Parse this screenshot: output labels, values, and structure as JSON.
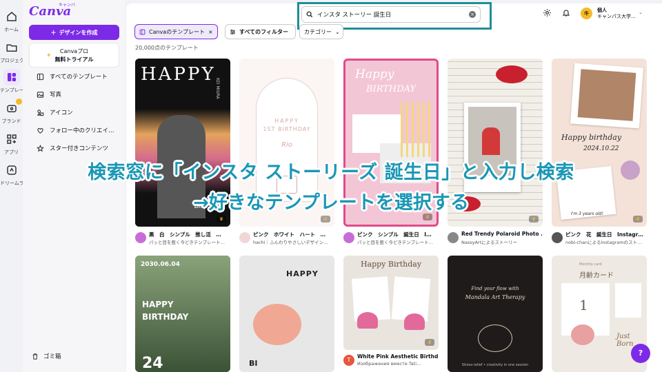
{
  "rail": {
    "items": [
      {
        "label": "ホーム",
        "icon": "home-icon"
      },
      {
        "label": "プロジェクト",
        "icon": "folder-icon"
      },
      {
        "label": "テンプレート",
        "icon": "template-icon"
      },
      {
        "label": "ブランド",
        "icon": "brand-icon"
      },
      {
        "label": "アプリ",
        "icon": "apps-icon"
      },
      {
        "label": "ドリームラボ",
        "icon": "dream-lab-icon"
      }
    ]
  },
  "panel": {
    "logo": "Canva",
    "logo_sub": "キャンバ",
    "create_label": "デザインを作成",
    "pro_line1": "Canvaプロ",
    "pro_line2": "無料トライアル",
    "nav": [
      {
        "label": "すべてのテンプレート"
      },
      {
        "label": "写真"
      },
      {
        "label": "アイコン"
      },
      {
        "label": "フォロー中のクリエイ…"
      },
      {
        "label": "スター付きコンテンツ"
      }
    ],
    "trash_label": "ゴミ箱"
  },
  "header": {
    "search_value": "インスタ ストーリー 誕生日",
    "user_name": "個人",
    "user_org": "キャンパス大学...",
    "avatar_initial": "キ"
  },
  "filters": {
    "selected_chip": "Canvaのテンプレート",
    "all_filters": "すべてのフィルター",
    "category": "カテゴリー"
  },
  "result_count": "20,000点のテンプレート",
  "templates": [
    {
      "title": "黒　白　シンプル　推し活　…",
      "author": "パッと目を惹く今どきテンプレート…",
      "art": "HAPPY",
      "art2": "KEI MIURA",
      "art3": "BIRTHDAY",
      "av": "#c86dd7"
    },
    {
      "title": "ピンク　ホワイト　ハート　…",
      "author": "hachi｜ふんわりやさしいデザイン…",
      "art": "HAPPY",
      "art2": "1ST BIRTHDAY",
      "art3": "Rio",
      "av": "#f1d6d8"
    },
    {
      "title": "ピンク　シンプル　誕生日　I…",
      "author": "パッと目を惹く今どきテンプレート…",
      "art": "Happy",
      "art2": "BIRTHDAY",
      "art3": "",
      "av": "#c86dd7"
    },
    {
      "title": "Red Trendy Polaroid Photo …",
      "author": "NassyArtによるストーリー",
      "art": "",
      "art2": "",
      "art3": "",
      "av": "#888888"
    },
    {
      "title": "ピンク　花　誕生日　Instagr…",
      "author": "nobi-chanによるInstagramのスト…",
      "art": "Happy birthday",
      "art2": "2024.10.22",
      "art3": "I'm 3 years old!",
      "av": "#555555"
    },
    {
      "title": "",
      "author": "",
      "art": "HAPPY",
      "art2": "BIRTHDAY",
      "art3": "2030.06.04",
      "art4": "24",
      "av": ""
    },
    {
      "title": "",
      "author": "",
      "art": "HAPPY",
      "art2": "BI",
      "art3": "",
      "av": ""
    },
    {
      "title": "White Pink Aesthetic Birthd…",
      "author": "Изображения вместе Tati…",
      "art": "Happy Birthday",
      "art2": "",
      "art3": "",
      "av": "#e8563d",
      "av_letter": "T"
    },
    {
      "title": "",
      "author": "",
      "art": "Find your flow with",
      "art2": "Mandala Art Therapy",
      "art3": "Stress-relief • creativity in one session",
      "av": ""
    },
    {
      "title": "",
      "author": "",
      "art": "月齢カード",
      "art2": "1",
      "art3": "Just Born",
      "art4": "Monthly card",
      "av": ""
    }
  ],
  "caption": {
    "line1": "検索窓に「インスタ ストーリーズ 誕生日」と入力し検索",
    "line2": "→好きなテンプレートを選択する"
  },
  "help_label": "?",
  "colors": {
    "accent": "#7d2ae8",
    "caption": "#1a97b5",
    "highlight": "#1f8d96"
  }
}
